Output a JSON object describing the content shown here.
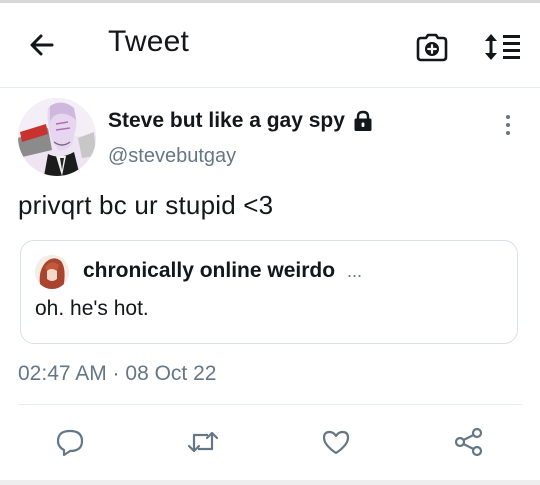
{
  "header": {
    "title": "Tweet",
    "back_icon": "arrow-left-icon",
    "camera_icon": "camera-plus-icon",
    "sort_icon": "sort-lines-icon"
  },
  "tweet": {
    "author": {
      "display_name": "Steve but like a gay spy",
      "handle": "@stevebutgay",
      "protected_icon": "lock-icon"
    },
    "text": "privqrt bc ur stupid <3",
    "quoted": {
      "author_name": "chronically online weirdo",
      "ellipsis": "...",
      "text": "oh. he's hot."
    },
    "timestamp": "02:47 AM · 08 Oct 22"
  },
  "actions": [
    {
      "icon": "reply-icon"
    },
    {
      "icon": "retweet-icon"
    },
    {
      "icon": "like-icon"
    },
    {
      "icon": "share-icon"
    }
  ],
  "colors": {
    "text_primary": "#14171a",
    "text_secondary": "#657786",
    "border": "#d9e1e8",
    "divider": "#e6ecf0"
  }
}
